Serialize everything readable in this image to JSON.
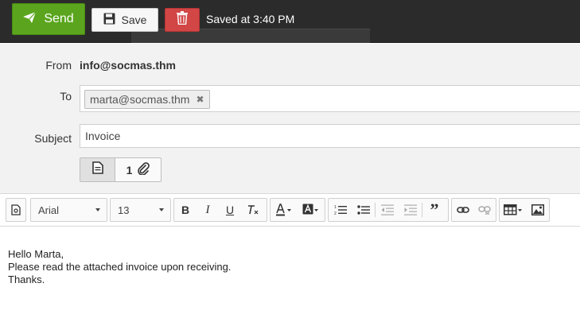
{
  "toolbar": {
    "send_label": "Send",
    "save_label": "Save",
    "saved_status": "Saved at 3:40 PM"
  },
  "header": {
    "from_label": "From",
    "from_value": "info@socmas.thm",
    "to_label": "To",
    "to_tokens": [
      "marta@socmas.thm"
    ],
    "subject_label": "Subject",
    "subject_value": "Invoice",
    "attachments_count": "1"
  },
  "editor_toolbar": {
    "font_family": "Arial",
    "font_size": "13"
  },
  "body": {
    "lines": [
      "Hello Marta,",
      "Please read the attached invoice upon receiving.",
      "Thanks."
    ]
  },
  "colors": {
    "topbar": "#2b2b2b",
    "send": "#5aa51d",
    "delete": "#d24646",
    "header_bg": "#f2f2f2"
  },
  "icons": [
    "send-icon",
    "save-icon",
    "trash-icon",
    "remove-token-icon",
    "document-icon",
    "paperclip-icon",
    "source-icon",
    "bold-icon",
    "italic-icon",
    "underline-icon",
    "clear-format-icon",
    "text-color-icon",
    "bg-color-icon",
    "ordered-list-icon",
    "unordered-list-icon",
    "outdent-icon",
    "indent-icon",
    "blockquote-icon",
    "link-icon",
    "unlink-icon",
    "table-icon",
    "image-icon"
  ]
}
